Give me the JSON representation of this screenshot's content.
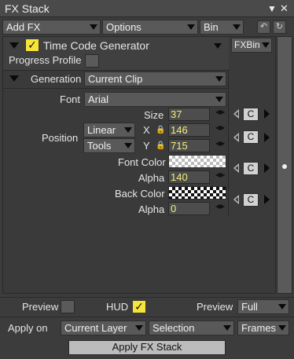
{
  "window": {
    "title": "FX Stack"
  },
  "toolbar": {
    "add_fx": "Add FX",
    "options": "Options",
    "bin": "Bin"
  },
  "effect": {
    "name": "Time Code Generator",
    "enabled": true,
    "fxbin_label": "FXBin",
    "progress_profile_label": "Progress Profile"
  },
  "generation": {
    "label": "Generation",
    "value": "Current Clip"
  },
  "font": {
    "label": "Font",
    "value": "Arial"
  },
  "size": {
    "label": "Size",
    "value": "37"
  },
  "position": {
    "label": "Position",
    "mode": "Linear",
    "tools": "Tools",
    "x_label": "X",
    "x_value": "146",
    "y_label": "Y",
    "y_value": "715"
  },
  "font_color": {
    "label": "Font Color",
    "alpha_label": "Alpha",
    "alpha_value": "140"
  },
  "back_color": {
    "label": "Back Color",
    "alpha_label": "Alpha",
    "alpha_value": "0"
  },
  "keyframe_button_label": "C",
  "footer": {
    "preview_label": "Preview",
    "hud_label": "HUD",
    "hud_checked": true,
    "preview_quality_label": "Preview",
    "preview_quality_value": "Full",
    "apply_on_label": "Apply on",
    "apply_on_value": "Current Layer",
    "selection_value": "Selection",
    "frames_value": "Frames",
    "apply_button": "Apply FX Stack"
  },
  "colors": {
    "background": "#3c3c3c",
    "checkbox_on": "#f6e536",
    "field_text": "#f4ee7a"
  }
}
